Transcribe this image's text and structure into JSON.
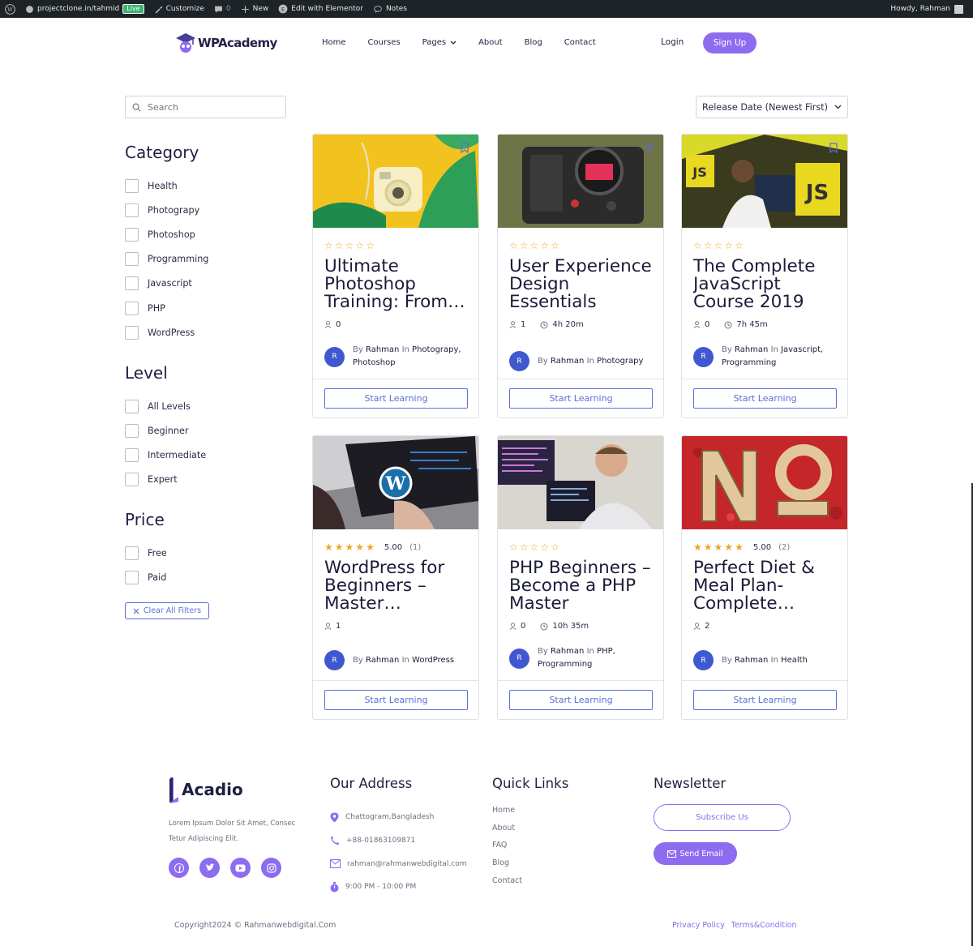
{
  "adminbar": {
    "site": "projectclone.in/tahmid",
    "live": "Live",
    "customize": "Customize",
    "comments": "0",
    "new": "New",
    "elementor": "Edit with Elementor",
    "notes": "Notes",
    "howdy": "Howdy, Rahman"
  },
  "header": {
    "logo": "WPAcademy",
    "nav": [
      "Home",
      "Courses",
      "Pages",
      "About",
      "Blog",
      "Contact"
    ],
    "login": "Login",
    "signup": "Sign Up"
  },
  "search": {
    "placeholder": "Search"
  },
  "sort": {
    "selected": "Release Date (Newest First)"
  },
  "filters": {
    "category": {
      "title": "Category",
      "items": [
        "Health",
        "Photograpy",
        "Photoshop",
        "Programming",
        "Javascript",
        "PHP",
        "WordPress"
      ]
    },
    "level": {
      "title": "Level",
      "items": [
        "All Levels",
        "Beginner",
        "Intermediate",
        "Expert"
      ]
    },
    "price": {
      "title": "Price",
      "items": [
        "Free",
        "Paid"
      ]
    },
    "clear": "Clear All Filters"
  },
  "courses": [
    {
      "title": "Ultimate Photoshop Training: From…",
      "rating": "",
      "reviews": "",
      "stars_filled": 0,
      "students": "0",
      "duration": "",
      "author_initial": "R",
      "by": "By",
      "author": "Rahman",
      "in": "In",
      "categories": "Photograpy, Photoshop",
      "cta": "Start Learning"
    },
    {
      "title": "User Experience Design Essentials",
      "rating": "",
      "reviews": "",
      "stars_filled": 0,
      "students": "1",
      "duration": "4h 20m",
      "author_initial": "R",
      "by": "By",
      "author": "Rahman",
      "in": "In",
      "categories": "Photograpy",
      "cta": "Start Learning"
    },
    {
      "title": "The Complete JavaScript Course 2019",
      "rating": "",
      "reviews": "",
      "stars_filled": 0,
      "students": "0",
      "duration": "7h 45m",
      "author_initial": "R",
      "by": "By",
      "author": "Rahman",
      "in": "In",
      "categories": "Javascript, Programming",
      "cta": "Start Learning"
    },
    {
      "title": "WordPress for Beginners – Master…",
      "rating": "5.00",
      "reviews": "(1)",
      "stars_filled": 5,
      "students": "1",
      "duration": "",
      "author_initial": "R",
      "by": "By",
      "author": "Rahman",
      "in": "In",
      "categories": "WordPress",
      "cta": "Start Learning"
    },
    {
      "title": "PHP Beginners – Become a PHP Master",
      "rating": "",
      "reviews": "",
      "stars_filled": 0,
      "students": "0",
      "duration": "10h 35m",
      "author_initial": "R",
      "by": "By",
      "author": "Rahman",
      "in": "In",
      "categories": "PHP, Programming",
      "cta": "Start Learning"
    },
    {
      "title": "Perfect Diet & Meal Plan- Complete…",
      "rating": "5.00",
      "reviews": "(2)",
      "stars_filled": 5,
      "students": "2",
      "duration": "",
      "author_initial": "R",
      "by": "By",
      "author": "Rahman",
      "in": "In",
      "categories": "Health",
      "cta": "Start Learning"
    }
  ],
  "footer": {
    "logo": "Acadio",
    "desc": "Lorem Ipsum Dolor Sit Amet, Consec Tetur Adipiscing Elit.",
    "address_title": "Our Address",
    "address": [
      "Chattogram,Bangladesh",
      "+88-01863109871",
      "rahman@rahmanwebdigital.com",
      "9:00 PM - 10:00 PM"
    ],
    "quick_title": "Quick Links",
    "quick_links": [
      "Home",
      "About",
      "FAQ",
      "Blog",
      "Contact"
    ],
    "newsletter_title": "Newsletter",
    "subscribe": "Subscribe Us",
    "send": "Send Email",
    "copyright": "Copyright2024 © Rahmanwebdigital.Com",
    "privacy": "Privacy Policy",
    "terms": "Terms&Condition"
  },
  "colors": {
    "accent": "#8d6cf0",
    "link_blue": "#5a6fd6",
    "star": "#f0a423",
    "avatar": "#4058cf"
  }
}
